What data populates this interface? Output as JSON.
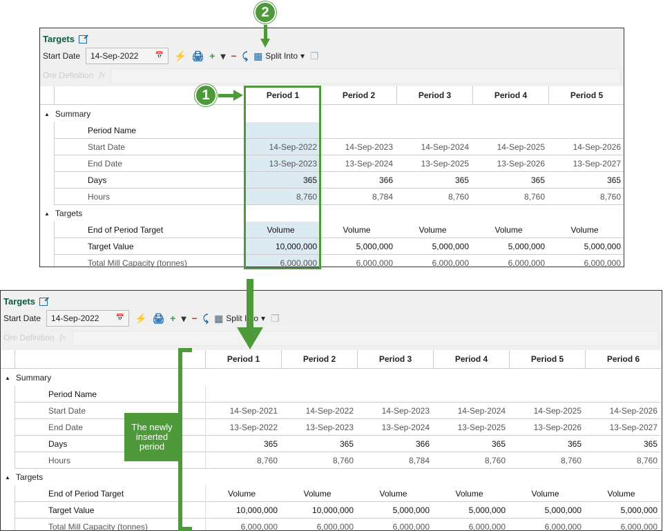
{
  "panels": [
    {
      "title": "Targets",
      "start_date_label": "Start Date",
      "start_date": "14-Sep-2022",
      "split_into": "Split Into",
      "formula_label": "Ore Definition",
      "periods": [
        "Period 1",
        "Period 2",
        "Period 3",
        "Period 4",
        "Period 5"
      ],
      "sections": [
        {
          "name": "Summary",
          "rows": [
            {
              "label": "Period Name",
              "values": [
                "",
                "",
                "",
                "",
                ""
              ]
            },
            {
              "label": "Start Date",
              "values": [
                "14-Sep-2022",
                "14-Sep-2023",
                "14-Sep-2024",
                "14-Sep-2025",
                "14-Sep-2026"
              ]
            },
            {
              "label": "End Date",
              "values": [
                "13-Sep-2023",
                "13-Sep-2024",
                "13-Sep-2025",
                "13-Sep-2026",
                "13-Sep-2027"
              ]
            },
            {
              "label": "Days",
              "values": [
                "365",
                "366",
                "365",
                "365",
                "365"
              ]
            },
            {
              "label": "Hours",
              "values": [
                "8,760",
                "8,784",
                "8,760",
                "8,760",
                "8,760"
              ]
            }
          ]
        },
        {
          "name": "Targets",
          "rows": [
            {
              "label": "End of Period Target",
              "values": [
                "Volume",
                "Volume",
                "Volume",
                "Volume",
                "Volume"
              ]
            },
            {
              "label": "Target Value",
              "values": [
                "10,000,000",
                "5,000,000",
                "5,000,000",
                "5,000,000",
                "5,000,000"
              ]
            },
            {
              "label": "Total Mill Capacity (tonnes)",
              "values": [
                "6,000,000",
                "6,000,000",
                "6,000,000",
                "6,000,000",
                "6,000,000"
              ]
            }
          ]
        }
      ]
    },
    {
      "title": "Targets",
      "start_date_label": "Start Date",
      "start_date": "14-Sep-2022",
      "split_into": "Split Into",
      "formula_label": "Ore Definition",
      "periods": [
        "Period 1",
        "Period 2",
        "Period 3",
        "Period 4",
        "Period 5",
        "Period 6"
      ],
      "sections": [
        {
          "name": "Summary",
          "rows": [
            {
              "label": "Period Name",
              "values": [
                "",
                "",
                "",
                "",
                "",
                ""
              ]
            },
            {
              "label": "Start Date",
              "values": [
                "14-Sep-2021",
                "14-Sep-2022",
                "14-Sep-2023",
                "14-Sep-2024",
                "14-Sep-2025",
                "14-Sep-2026"
              ]
            },
            {
              "label": "End Date",
              "values": [
                "13-Sep-2022",
                "13-Sep-2023",
                "13-Sep-2024",
                "13-Sep-2025",
                "13-Sep-2026",
                "13-Sep-2027"
              ]
            },
            {
              "label": "Days",
              "values": [
                "365",
                "365",
                "366",
                "365",
                "365",
                "365"
              ]
            },
            {
              "label": "Hours",
              "values": [
                "8,760",
                "8,760",
                "8,784",
                "8,760",
                "8,760",
                "8,760"
              ]
            }
          ]
        },
        {
          "name": "Targets",
          "rows": [
            {
              "label": "End of Period Target",
              "values": [
                "Volume",
                "Volume",
                "Volume",
                "Volume",
                "Volume",
                "Volume"
              ]
            },
            {
              "label": "Target Value",
              "values": [
                "10,000,000",
                "10,000,000",
                "5,000,000",
                "5,000,000",
                "5,000,000",
                "5,000,000"
              ]
            },
            {
              "label": "Total Mill Capacity (tonnes)",
              "values": [
                "6,000,000",
                "6,000,000",
                "6,000,000",
                "6,000,000",
                "6,000,000",
                "6,000,000"
              ]
            }
          ]
        }
      ]
    }
  ],
  "annotations": {
    "step1": "1",
    "step2": "2",
    "callout": "The newly inserted period"
  },
  "colors": {
    "accent": "#4e9a3a",
    "title": "#0b5a3a",
    "selected": "#dbe9f0"
  }
}
